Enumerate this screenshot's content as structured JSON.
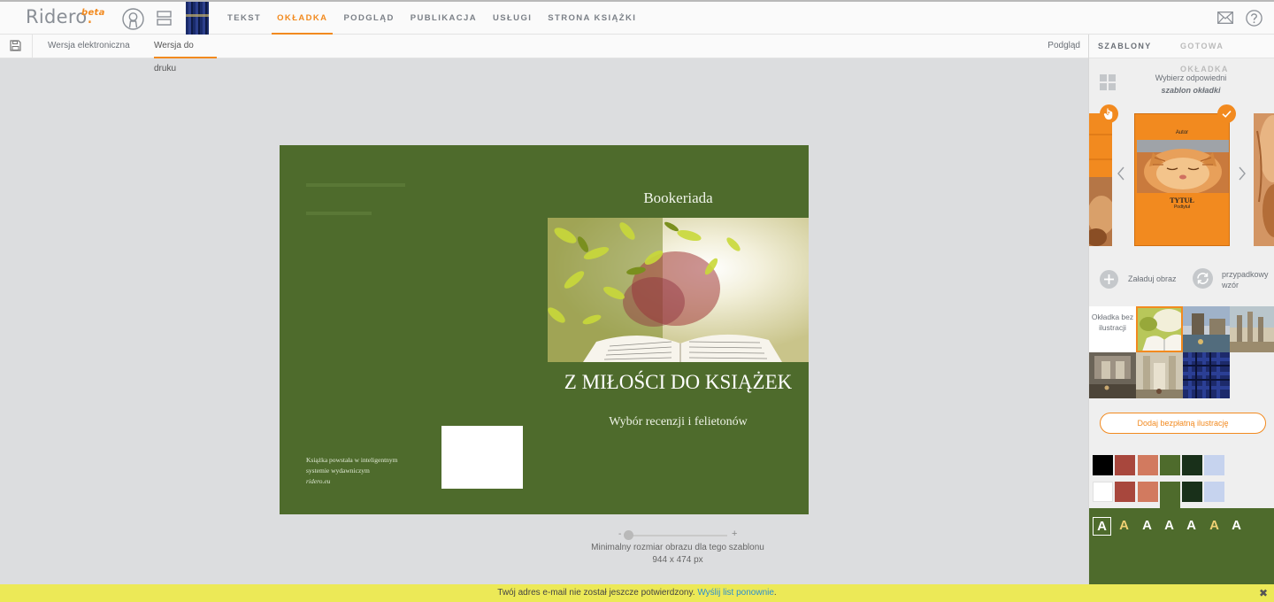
{
  "header": {
    "logo_text": "Ridero",
    "logo_dot": ".",
    "logo_badge": "beta",
    "nav": [
      {
        "label": "Tekst"
      },
      {
        "label": "Okładka"
      },
      {
        "label": "Podgląd"
      },
      {
        "label": "Publikacja"
      },
      {
        "label": "Usługi"
      },
      {
        "label": "Strona książki"
      }
    ]
  },
  "subbar": {
    "tabs": [
      {
        "label": "Wersja elektroniczna"
      },
      {
        "label": "Wersja do druku"
      }
    ],
    "preview_label": "Podgląd"
  },
  "cover": {
    "publisher": "Bookeriada",
    "title": "Z MIŁOŚCI DO KSIĄŻEK",
    "subtitle": "Wybór recenzji i felietonów",
    "back_line1": "Książka powstała w inteligentnym",
    "back_line2": "systemie wydawniczym",
    "back_line3": "ridero.eu",
    "colors": {
      "background": "#4e6b2c"
    }
  },
  "canvas": {
    "zoom_minus": "-",
    "zoom_plus": "+",
    "zoom_level": 0.0,
    "min_size_label": "Minimalny rozmiar obrazu dla tego szablonu",
    "min_size_value": "944 x 474 px"
  },
  "panel": {
    "tabs": [
      {
        "label": "Szablony"
      },
      {
        "label": "Gotowa okładka"
      }
    ],
    "choose_line1": "Wybierz odpowiedni",
    "choose_line2": "szablon okładki",
    "template": {
      "author": "Autor",
      "title": "TYTUŁ",
      "subtitle": "Podtytuł"
    },
    "upload_label": "Załaduj obraz",
    "random_label": "przypadkowy wzór",
    "no_illustration": "Okładka bez ilustracji",
    "add_illustration": "Dodaj bezpłatną ilustrację",
    "swatches_row1": [
      "#000000",
      "#a8473d",
      "#d27a5f",
      "#4e6b2c",
      "#19301a",
      "#c6d3ee"
    ],
    "swatches_row2": [
      "#ffffff",
      "#a8473d",
      "#d27a5f",
      "#4e6b2c",
      "#19301a",
      "#c6d3ee"
    ],
    "font_letter": "A",
    "font_colors": [
      "#ffffff",
      "#f0d074",
      "#ffffff",
      "#ffffff",
      "#ffffff",
      "#f0d074",
      "#ffffff"
    ]
  },
  "notice": {
    "text": "Twój adres e-mail nie został jeszcze potwierdzony.",
    "link": "Wyślij list ponownie",
    "end": ".",
    "close": "✖"
  }
}
